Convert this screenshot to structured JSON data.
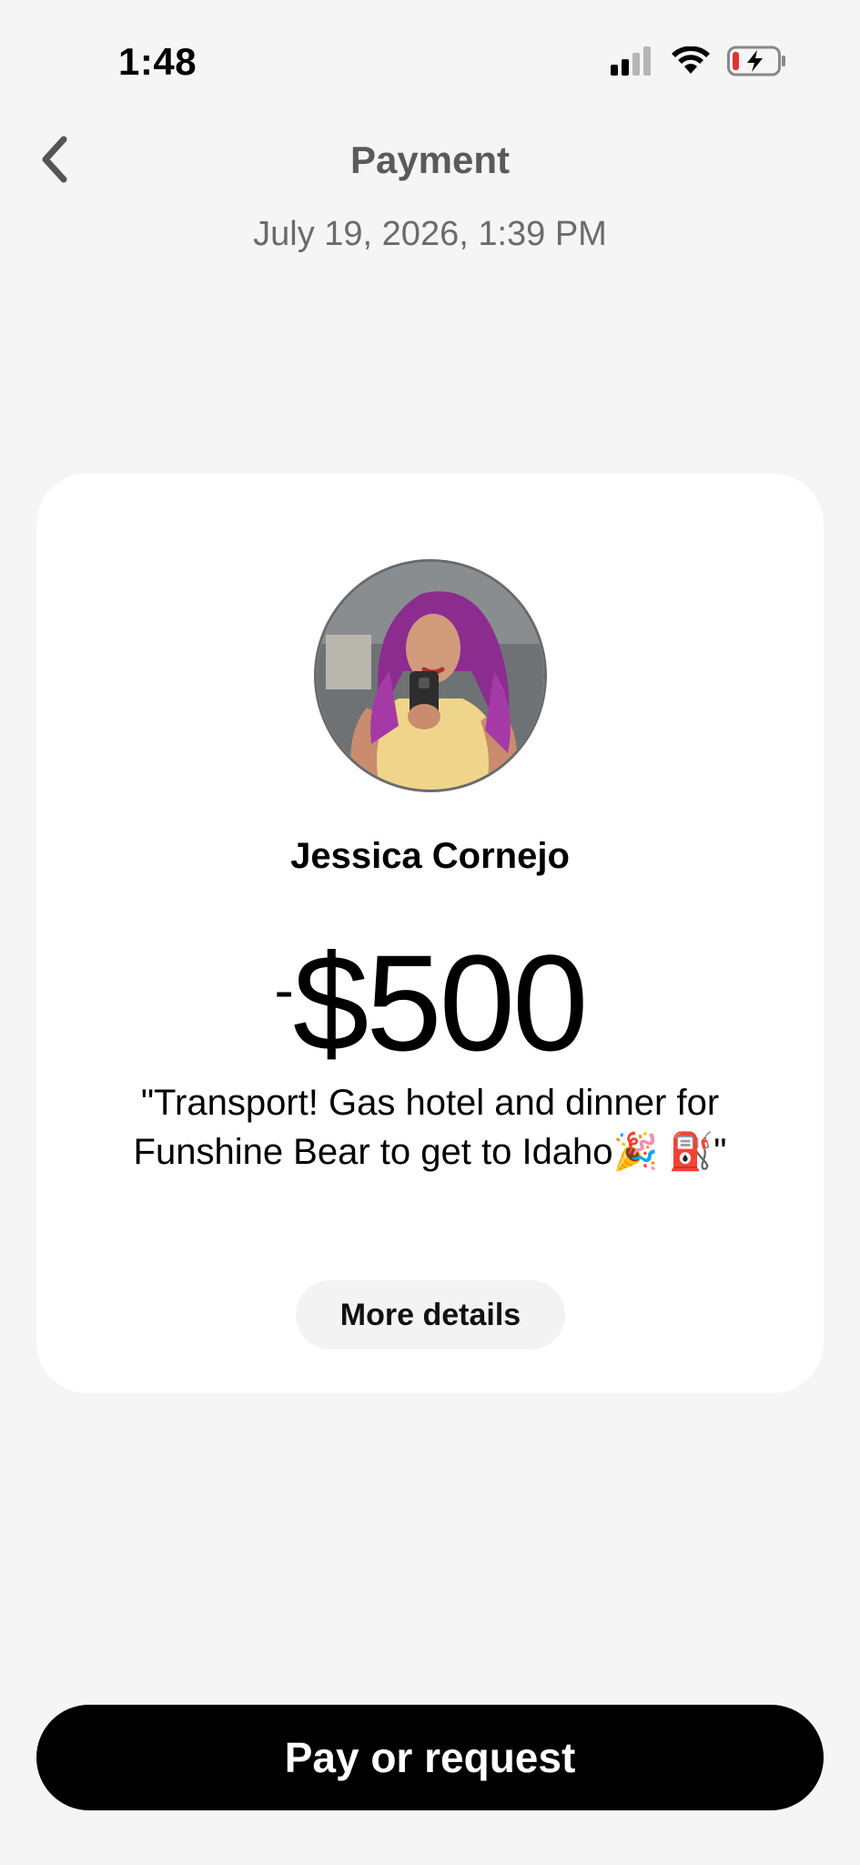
{
  "status_bar": {
    "time": "1:48",
    "icons": [
      "signal-icon",
      "wifi-icon",
      "battery-charging-icon"
    ]
  },
  "header": {
    "back_icon": "chevron-left-icon",
    "title": "Payment",
    "subtitle": "July 19, 2026, 1:39 PM"
  },
  "card": {
    "avatar": "profile-photo",
    "payee_name": "Jessica Cornejo",
    "amount_sign": "-",
    "amount": "$500",
    "note": "\"Transport!  Gas hotel and dinner for Funshine Bear to get to  Idaho🎉 ⛽\"",
    "details_label": "More details"
  },
  "footer": {
    "cta_label": "Pay or request"
  },
  "colors": {
    "background": "#f5f5f5",
    "card": "#ffffff",
    "cta_background": "#000000",
    "cta_text": "#ffffff",
    "title": "#5a5a5a",
    "battery_low": "#e0332f"
  }
}
